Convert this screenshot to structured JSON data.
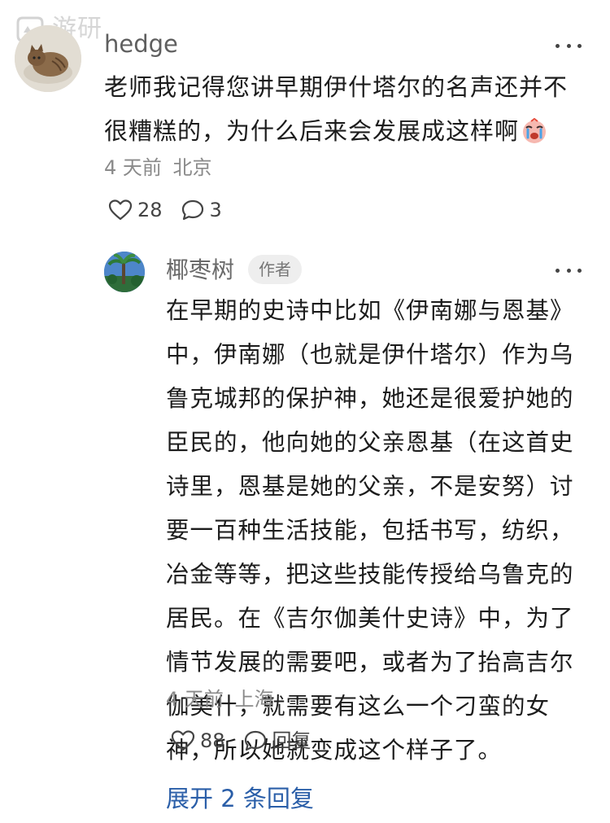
{
  "watermark": {
    "text": "游研社"
  },
  "main_comment": {
    "username": "hedge",
    "text": "老师我记得您讲早期伊什塔尔的名声还并不很糟糕的，为什么后来会发展成这样啊",
    "emoji_icon": "crying-face-emoji-icon",
    "time": "4 天前",
    "location": "北京",
    "likes": "28",
    "replies": "3"
  },
  "reply_comment": {
    "username": "椰枣树",
    "badge": "作者",
    "text": "在早期的史诗中比如《伊南娜与恩基》中，伊南娜（也就是伊什塔尔）作为乌鲁克城邦的保护神，她还是很爱护她的臣民的，他向她的父亲恩基（在这首史诗里，恩基是她的父亲，不是安努）讨要一百种生活技能，包括书写，纺织，冶金等等，把这些技能传授给乌鲁克的居民。在《吉尔伽美什史诗》中，为了情节发展的需要吧，或者为了抬高吉尔伽美什，就需要有这么一个刁蛮的女神，所以她就变成这个样子了。",
    "time": "4 天前",
    "location": "上海",
    "likes": "88",
    "reply_label": "回复"
  },
  "expand_replies": {
    "label": "展开 2 条回复"
  },
  "colors": {
    "accent_link": "#2a5ea8",
    "meta_gray": "#8a8a8a",
    "badge_bg": "#eeeeee"
  }
}
